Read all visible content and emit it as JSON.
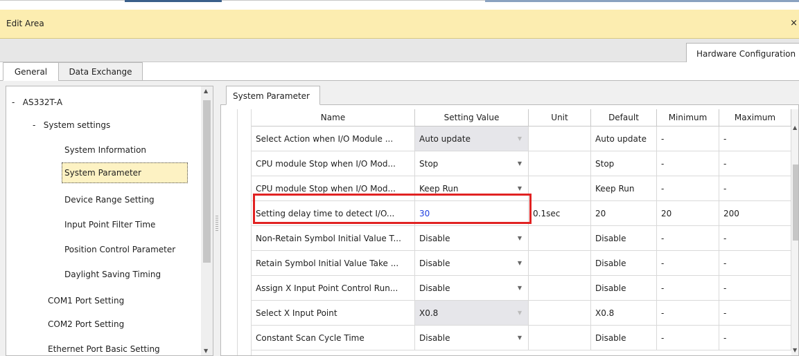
{
  "window": {
    "title": "Edit Area",
    "close_glyph": "×"
  },
  "hw_tab": {
    "label": "Hardware Configuration"
  },
  "main_tabs": [
    {
      "label": "General",
      "active": true
    },
    {
      "label": "Data Exchange",
      "active": false
    }
  ],
  "tree": {
    "root": {
      "toggle": "-",
      "label": "AS332T-A"
    },
    "group": {
      "toggle": "-",
      "label": "System settings"
    },
    "items": [
      {
        "label": "System Information",
        "selected": false
      },
      {
        "label": "System Parameter",
        "selected": true
      },
      {
        "label": "Device Range Setting",
        "selected": false
      },
      {
        "label": "Input Point Filter Time",
        "selected": false
      },
      {
        "label": "Position Control Parameter",
        "selected": false
      },
      {
        "label": "Daylight Saving Timing",
        "selected": false
      }
    ],
    "ports": [
      {
        "label": "COM1 Port Setting"
      },
      {
        "label": "COM2 Port Setting"
      },
      {
        "label": "Ethernet Port Basic Setting"
      }
    ]
  },
  "param_tab": {
    "label": "System Parameter"
  },
  "grid": {
    "columns": [
      "Name",
      "Setting Value",
      "Unit",
      "Default",
      "Minimum",
      "Maximum"
    ],
    "rows": [
      {
        "name": "Select Action when I/O Module ...",
        "value": "Auto update",
        "unit": "",
        "default": "Auto update",
        "min": "-",
        "max": "-",
        "gray": true,
        "dd": "dim"
      },
      {
        "name": "CPU module Stop when I/O Mod...",
        "value": "Stop",
        "unit": "",
        "default": "Stop",
        "min": "-",
        "max": "-",
        "gray": false,
        "dd": "on"
      },
      {
        "name": "CPU module Stop when I/O Mod...",
        "value": "Keep Run",
        "unit": "",
        "default": "Keep Run",
        "min": "-",
        "max": "-",
        "gray": false,
        "dd": "on"
      },
      {
        "name": "Setting delay time to detect I/O...",
        "value": "30",
        "unit": "0.1sec",
        "default": "20",
        "min": "20",
        "max": "200",
        "gray": false,
        "dd": "none",
        "edited": true
      },
      {
        "name": "Non-Retain Symbol Initial Value T...",
        "value": "Disable",
        "unit": "",
        "default": "Disable",
        "min": "-",
        "max": "-",
        "gray": false,
        "dd": "on"
      },
      {
        "name": "Retain Symbol Initial Value Take ...",
        "value": "Disable",
        "unit": "",
        "default": "Disable",
        "min": "-",
        "max": "-",
        "gray": false,
        "dd": "on"
      },
      {
        "name": "Assign X Input Point Control Run...",
        "value": "Disable",
        "unit": "",
        "default": "Disable",
        "min": "-",
        "max": "-",
        "gray": false,
        "dd": "on"
      },
      {
        "name": "Select X Input Point",
        "value": "X0.8",
        "unit": "",
        "default": "X0.8",
        "min": "-",
        "max": "-",
        "gray": true,
        "dd": "dim"
      },
      {
        "name": "Constant Scan Cycle Time",
        "value": "Disable",
        "unit": "",
        "default": "Disable",
        "min": "-",
        "max": "-",
        "gray": false,
        "dd": "on"
      }
    ]
  },
  "colors": {
    "highlight": "#e12222",
    "edited_value": "#1c3ee0",
    "titlebar": "#fcedb0",
    "selected_item": "#fdf2c3"
  },
  "icons": {
    "dropdown": "triangle-down",
    "scroll_up": "triangle-up",
    "scroll_down": "triangle-down",
    "close": "x-glyph"
  }
}
